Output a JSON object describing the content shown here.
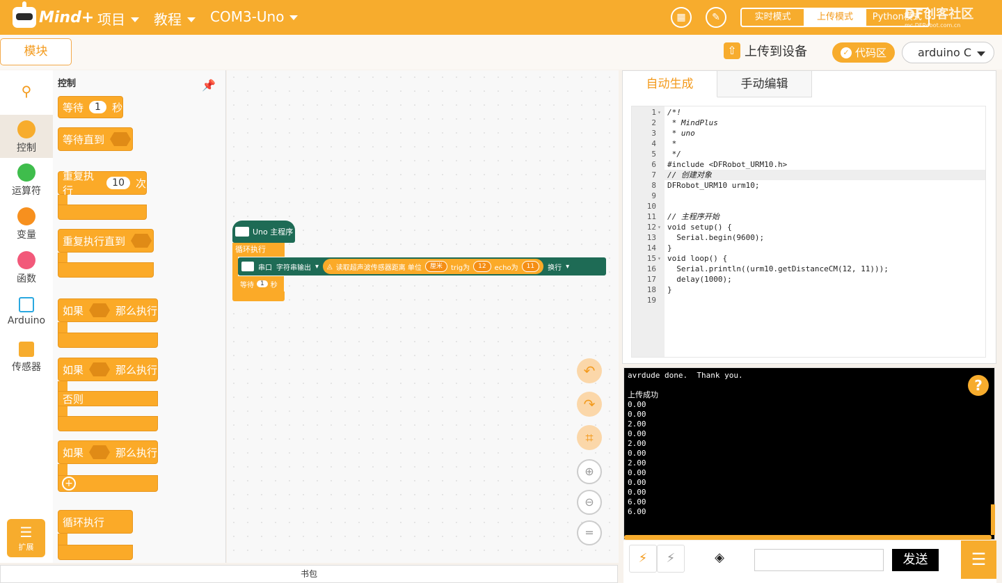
{
  "app": {
    "logo_text": "Mind+"
  },
  "topbar": {
    "menus": [
      {
        "label": "项目"
      },
      {
        "label": "教程"
      },
      {
        "label": "COM3-Uno"
      }
    ],
    "modes": [
      "实时模式",
      "上传模式",
      "Python模式"
    ],
    "active_mode": "上传模式",
    "brand": "DF创客社区",
    "brand_sub": "mc.DFRobot.com.cn"
  },
  "subbar": {
    "blocks_tab": "模块",
    "upload_label": "上传到设备",
    "code_area_label": "代码区",
    "board_select": "arduino C"
  },
  "categories": [
    {
      "label": "控制",
      "color": "#f7ac2d"
    },
    {
      "label": "运算符",
      "color": "#3fbd4c"
    },
    {
      "label": "变量",
      "color": "#f7901e"
    },
    {
      "label": "函数",
      "color": "#f2597a"
    },
    {
      "label": "Arduino",
      "color": "#2aa8e0"
    },
    {
      "label": "传感器",
      "color": "#f7ac2d"
    }
  ],
  "extension_label": "扩展",
  "palette": {
    "title": "控制",
    "wait": {
      "label": "等待",
      "value": "1",
      "unit": "秒"
    },
    "wait_until": "等待直到",
    "repeat": {
      "label": "重复执行",
      "value": "10",
      "unit": "次"
    },
    "repeat_until": "重复执行直到",
    "if_then": {
      "label": "如果",
      "then": "那么执行"
    },
    "if_else": {
      "label": "如果",
      "then": "那么执行",
      "else": "否则"
    },
    "if_then_plus": {
      "label": "如果",
      "then": "那么执行"
    },
    "forever": "循环执行"
  },
  "workspace": {
    "hat": "Uno 主程序",
    "loop": "循环执行",
    "serial": {
      "label": "串口",
      "mode": "字符串输出",
      "sensor": "读取超声波传感器距离 单位",
      "unit": "厘米",
      "trig_label": "trig为",
      "trig": "12",
      "echo_label": "echo为",
      "echo": "11",
      "newline": "换行"
    },
    "wait": {
      "label": "等待",
      "value": "1",
      "unit": "秒"
    },
    "backpack": "书包"
  },
  "code_tabs": [
    "自动生成",
    "手动编辑"
  ],
  "code_lines": [
    "/*!",
    " * MindPlus",
    " * uno",
    " *",
    " */",
    "#include <DFRobot_URM10.h>",
    "// 创建对象",
    "DFRobot_URM10 urm10;",
    "",
    "",
    "// 主程序开始",
    "void setup() {",
    "  Serial.begin(9600);",
    "}",
    "void loop() {",
    "  Serial.println((urm10.getDistanceCM(12, 11)));",
    "  delay(1000);",
    "}",
    ""
  ],
  "console_lines": [
    "avrdude done.  Thank you.",
    "",
    "上传成功",
    "0.00",
    "0.00",
    "2.00",
    "0.00",
    "2.00",
    "0.00",
    "2.00",
    "0.00",
    "0.00",
    "0.00",
    "6.00",
    "6.00"
  ],
  "bottom": {
    "send_label": "发送",
    "send_value": ""
  }
}
